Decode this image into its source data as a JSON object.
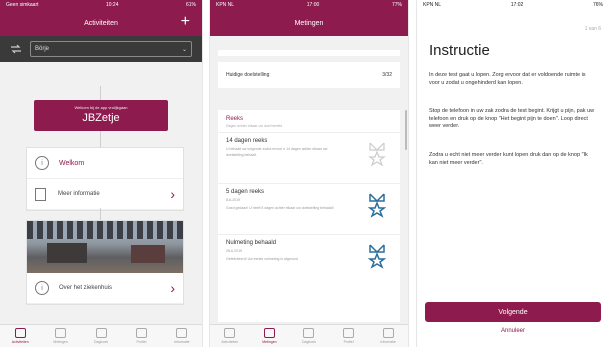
{
  "phone1": {
    "status": {
      "carrier": "Geen simkaart",
      "time": "10:24",
      "battery": "61%"
    },
    "title": "Activiteiten",
    "plus_icon": "plus-icon",
    "select_value": "Börje",
    "banner_small": "Welkom bij de app vrolijkgaan",
    "banner_big": "JBZetje",
    "welcome_label": "Welkom",
    "more_info_label": "Meer informatie",
    "about_label": "Over het ziekenhuis",
    "tabs": [
      "Activiteiten",
      "Metingen",
      "Dagboek",
      "Profiel",
      "Informatie"
    ]
  },
  "phone2": {
    "status": {
      "carrier": "KPN NL",
      "time": "17:00",
      "battery": "77%"
    },
    "title": "Metingen",
    "current_label": "Huidige doelstelling",
    "current_value": "3/32",
    "section_title": "Reeks",
    "section_sub": "Dagen achter elkaar uw doel bereikt",
    "items": [
      {
        "title": "14 dagen reeks",
        "desc": "U behaalt uw volgende zodra ervoor u 14 dagen achter elkaar uw doelstelling behaalt."
      },
      {
        "title": "5 dagen reeks",
        "date": "8-6-2019",
        "desc": "Goed gedaan! U heeft 5 dagen achter elkaar uw doelstelling behaald!"
      },
      {
        "title": "Nulmeting behaald",
        "date": "28-6-2019",
        "desc": "Gefeliciteerd! Uw eerste nulmeting is afgerond"
      }
    ],
    "tabs": [
      "Activiteiten",
      "Metingen",
      "Dagboek",
      "Profiel",
      "Informatie"
    ]
  },
  "phone3": {
    "status": {
      "carrier": "KPN NL",
      "time": "17:02",
      "battery": "76%"
    },
    "page_indicator": "1 van 6",
    "title": "Instructie",
    "p1": "In deze test gaat u lopen. Zorg ervoor dat er voldoende ruimte is voor u zodat u ongehinderd kan lopen.",
    "p2": "Stop de telefoon in uw zak zodra de test begint. Krijgt u pijn, pak uw telefoon en druk op de knop \"Het begint pijn te doen\". Loop direct weer verder.",
    "p3": "Zodra u echt niet meer verder kunt lopen druk dan op de knop \"Ik kan niet meer verder\".",
    "next_label": "Volgende",
    "cancel_label": "Annuleer"
  },
  "colors": {
    "brand": "#8e1b4d",
    "dark_bar": "#3a3a3a"
  }
}
